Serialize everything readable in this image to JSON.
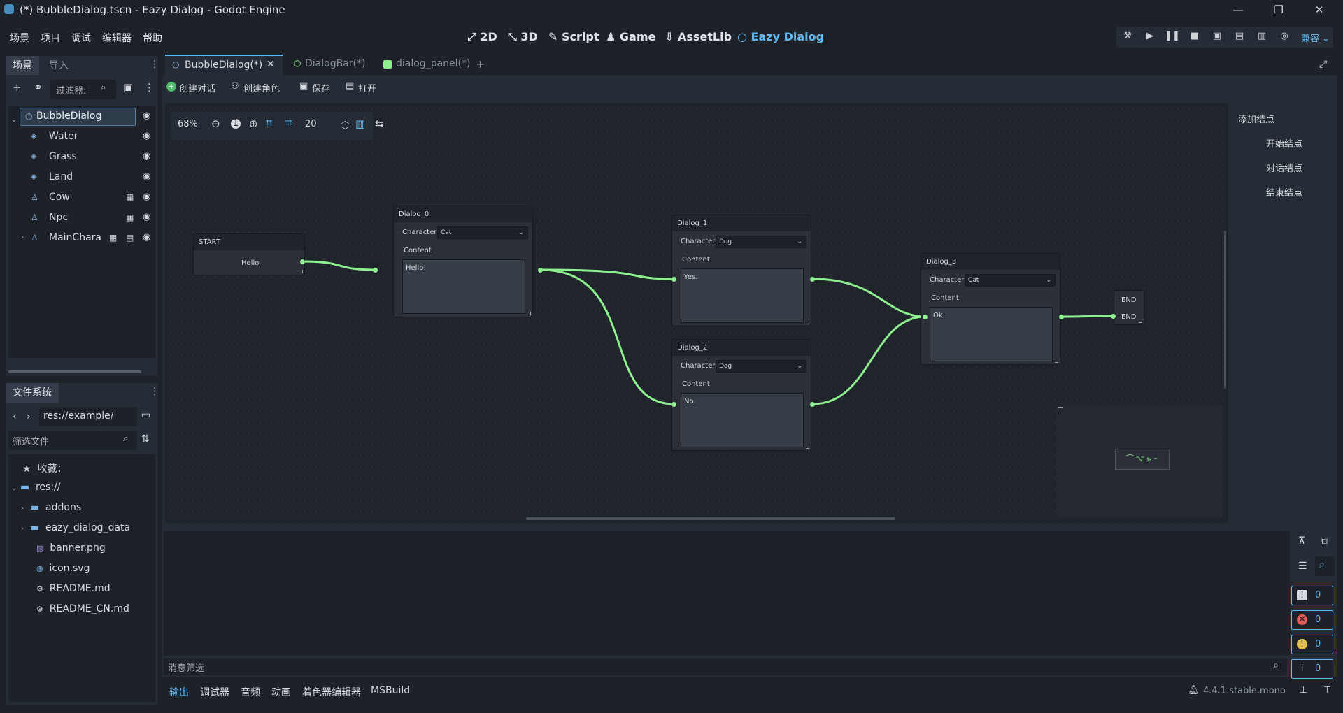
{
  "window": {
    "title": "(*) BubbleDialog.tscn - Eazy Dialog - Godot Engine"
  },
  "menu": [
    "场景",
    "项目",
    "调试",
    "编辑器",
    "帮助"
  ],
  "workspaces": [
    {
      "label": "2D",
      "icon": "2d-icon"
    },
    {
      "label": "3D",
      "icon": "3d-icon"
    },
    {
      "label": "Script",
      "icon": "script-icon"
    },
    {
      "label": "Game",
      "icon": "game-icon"
    },
    {
      "label": "AssetLib",
      "icon": "assetlib-icon"
    },
    {
      "label": "Eazy Dialog",
      "icon": "eazy-dialog-icon",
      "active": true
    }
  ],
  "renderer": "兼容",
  "scene_dock": {
    "tabs": [
      "场景",
      "导入"
    ],
    "filter_placeholder": "过滤器:",
    "nodes": [
      {
        "name": "BubbleDialog",
        "icon": "node-circle-icon",
        "selected": true
      },
      {
        "name": "Water",
        "icon": "tilemap-icon"
      },
      {
        "name": "Grass",
        "icon": "tilemap-icon"
      },
      {
        "name": "Land",
        "icon": "tilemap-icon"
      },
      {
        "name": "Cow",
        "icon": "character-icon",
        "extra": "clapper-icon"
      },
      {
        "name": "Npc",
        "icon": "character-icon",
        "extra": "clapper-icon"
      },
      {
        "name": "MainChara",
        "icon": "character-icon",
        "extra": "clapper-icon",
        "extra2": "script-icon"
      }
    ]
  },
  "fs_dock": {
    "title": "文件系统",
    "path": "res://example/",
    "filter_placeholder": "筛选文件",
    "items": [
      {
        "name": "收藏：",
        "icon": "star-icon"
      },
      {
        "name": "res://",
        "icon": "folder-icon"
      },
      {
        "name": "addons",
        "icon": "folder-icon"
      },
      {
        "name": "eazy_dialog_data",
        "icon": "folder-icon"
      },
      {
        "name": "banner.png",
        "icon": "image-icon"
      },
      {
        "name": "icon.svg",
        "icon": "svg-icon"
      },
      {
        "name": "README.md",
        "icon": "text-icon"
      },
      {
        "name": "README_CN.md",
        "icon": "text-icon"
      }
    ]
  },
  "editor_tabs": [
    {
      "label": "BubbleDialog(*)",
      "active": true
    },
    {
      "label": "DialogBar(*)"
    },
    {
      "label": "dialog_panel(*)"
    }
  ],
  "toolbar": {
    "create_dialog": "创建对话",
    "create_role": "创建角色",
    "save": "保存",
    "open": "打开"
  },
  "graph": {
    "zoom": "68%",
    "reset": "1",
    "snap": "20"
  },
  "add_nodes": {
    "title": "添加结点",
    "items": [
      "开始结点",
      "对话结点",
      "结束结点"
    ]
  },
  "nodes": {
    "start": {
      "title": "START",
      "text": "Hello"
    },
    "d0": {
      "title": "Dialog_0",
      "char_label": "Character",
      "char": "Cat",
      "content_label": "Content",
      "content": "Hello!"
    },
    "d1": {
      "title": "Dialog_1",
      "char_label": "Character",
      "char": "Dog",
      "content_label": "Content",
      "content": "Yes."
    },
    "d2": {
      "title": "Dialog_2",
      "char_label": "Character",
      "char": "Dog",
      "content_label": "Content",
      "content": "No."
    },
    "d3": {
      "title": "Dialog_3",
      "char_label": "Character",
      "char": "Cat",
      "content_label": "Content",
      "content": "Ok."
    },
    "end": {
      "title": "END",
      "text": "END"
    }
  },
  "output": {
    "filter_placeholder": "消息筛选",
    "counts": [
      "0",
      "0",
      "0",
      "0"
    ]
  },
  "bottom_tabs": [
    "输出",
    "调试器",
    "音频",
    "动画",
    "着色器编辑器",
    "MSBuild"
  ],
  "version": "4.4.1.stable.mono",
  "colors": {
    "accent": "#5eb8f2",
    "wire": "#8ef08e"
  }
}
